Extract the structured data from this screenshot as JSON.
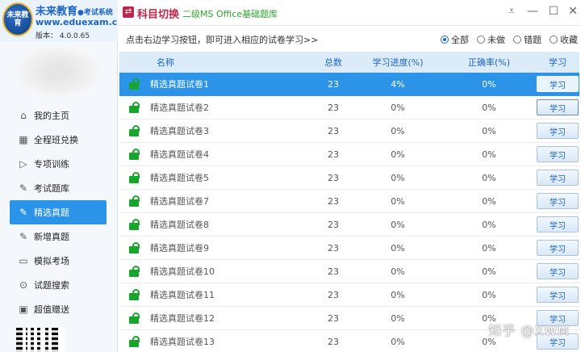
{
  "brand": {
    "logo_text": "未来教育",
    "name": "未来教育",
    "sub": "●考试系统",
    "url": "www.eduexam.cn",
    "version": "版本： 4.0.0.65"
  },
  "nav": [
    {
      "label": "我的主页",
      "icon": "home-icon"
    },
    {
      "label": "全程班兑换",
      "icon": "grid-icon"
    },
    {
      "label": "专项训练",
      "icon": "play-icon"
    },
    {
      "label": "考试题库",
      "icon": "pencil-icon"
    },
    {
      "label": "精选真题",
      "icon": "pencil-icon",
      "active": true
    },
    {
      "label": "新增真题",
      "icon": "pencil-icon"
    },
    {
      "label": "模拟考场",
      "icon": "monitor-icon"
    },
    {
      "label": "试题搜索",
      "icon": "search-icon"
    },
    {
      "label": "超值赠送",
      "icon": "gift-icon"
    }
  ],
  "header": {
    "switch_label": "科目切换",
    "subject": "二级MS Office基础题库"
  },
  "filterbar": {
    "hint": "点击右边学习按钮，即可进入相应的试卷学习>>",
    "options": [
      {
        "label": "全部",
        "selected": true
      },
      {
        "label": "未做",
        "selected": false
      },
      {
        "label": "错题",
        "selected": false
      },
      {
        "label": "收藏",
        "selected": false
      }
    ]
  },
  "table": {
    "headers": {
      "name": "名称",
      "total": "总数",
      "progress": "学习进度(%)",
      "rate": "正确率(%)",
      "action": "学习"
    },
    "rows": [
      {
        "name": "精选真题试卷1",
        "total": "23",
        "progress": "4%",
        "rate": "0%",
        "action": "学习"
      },
      {
        "name": "精选真题试卷2",
        "total": "23",
        "progress": "0%",
        "rate": "0%",
        "action": "学习"
      },
      {
        "name": "精选真题试卷3",
        "total": "23",
        "progress": "0%",
        "rate": "0%",
        "action": "学习"
      },
      {
        "name": "精选真题试卷4",
        "total": "23",
        "progress": "0%",
        "rate": "0%",
        "action": "学习"
      },
      {
        "name": "精选真题试卷5",
        "total": "23",
        "progress": "0%",
        "rate": "0%",
        "action": "学习"
      },
      {
        "name": "精选真题试卷7",
        "total": "23",
        "progress": "0%",
        "rate": "0%",
        "action": "学习"
      },
      {
        "name": "精选真题试卷8",
        "total": "23",
        "progress": "0%",
        "rate": "0%",
        "action": "学习"
      },
      {
        "name": "精选真题试卷9",
        "total": "23",
        "progress": "0%",
        "rate": "0%",
        "action": "学习"
      },
      {
        "name": "精选真题试卷10",
        "total": "23",
        "progress": "0%",
        "rate": "0%",
        "action": "学习"
      },
      {
        "name": "精选真题试卷11",
        "total": "23",
        "progress": "0%",
        "rate": "0%",
        "action": "学习"
      },
      {
        "name": "精选真题试卷12",
        "total": "23",
        "progress": "0%",
        "rate": "0%",
        "action": "学习"
      },
      {
        "name": "精选真题试卷13",
        "total": "23",
        "progress": "0%",
        "rate": "0%",
        "action": "学习"
      }
    ]
  },
  "watermark": "知乎 @XWM",
  "colors": {
    "accent": "#2b93e8",
    "brand": "#1c64c4",
    "switch": "#c0254a",
    "subject": "#2aa82a",
    "lock": "#18a52c"
  }
}
